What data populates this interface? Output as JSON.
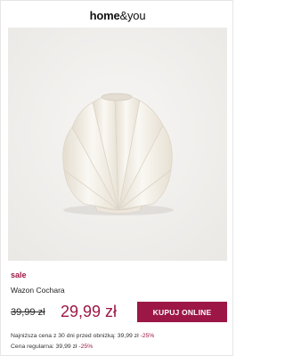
{
  "brand": {
    "name_bold": "home",
    "name_rest": "&you"
  },
  "product": {
    "image_alt": "Wazon Cochara",
    "badge": "sale",
    "name": "Wazon Cochara",
    "old_price": "39,99 zł",
    "new_price": "29,99 zł",
    "buy_label": "KUPUJ ONLINE",
    "lowest_price_text": "Najniższa cena z 30 dni przed obniżką: 39,99 zł",
    "lowest_price_pct": "-25%",
    "regular_price_text": "Cena regularna: 39,99 zł",
    "regular_price_pct": "-25%"
  },
  "colors": {
    "accent": "#9c1746",
    "image_background": "#f3f2f0",
    "vase": "#efebe3"
  }
}
